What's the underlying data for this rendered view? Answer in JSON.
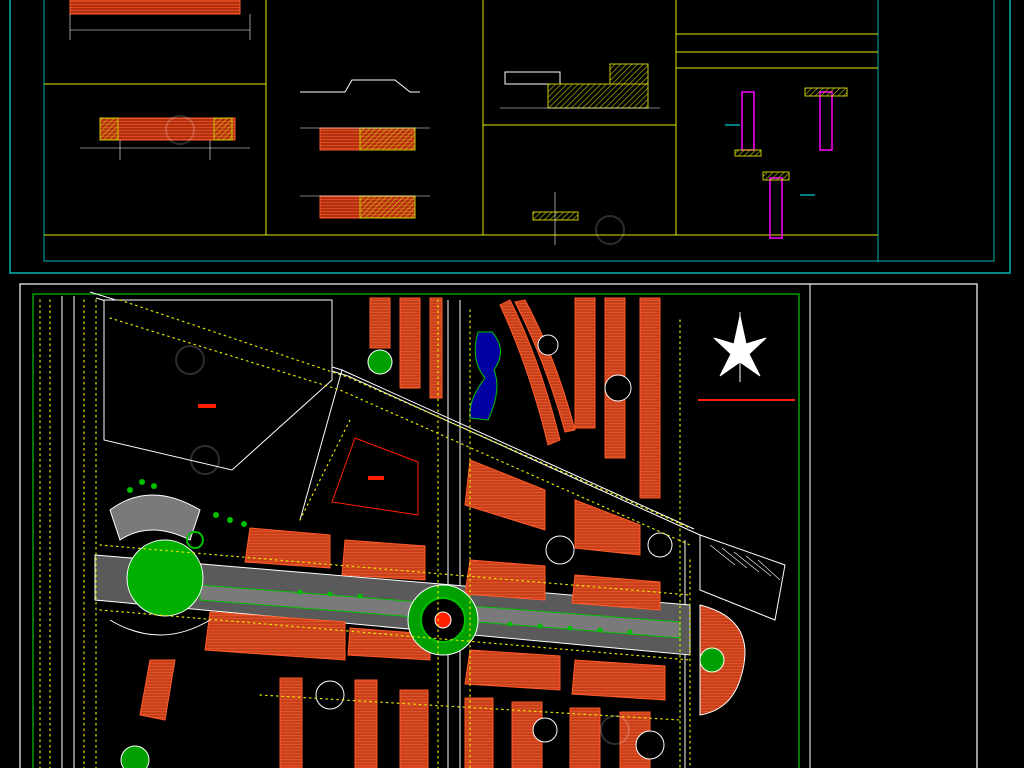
{
  "document": {
    "type": "CAD drawing sheets",
    "sheets": [
      {
        "role": "construction-details-sheet",
        "panels": 4
      },
      {
        "role": "site-master-plan"
      }
    ]
  },
  "colors": {
    "background": "#000000",
    "frame": "#00b3b3",
    "panel_line": "#e6e600",
    "detail_line": "#ffffff",
    "hatch": "#c8c800",
    "building_fill": "#c8401a",
    "building_edge": "#ff5a2a",
    "tree": "#e6e600",
    "lawn": "#00c000",
    "road": "#ffffff",
    "plaza": "#9a9a9a",
    "water": "#0000a0",
    "magenta": "#ff00ff",
    "cyan": "#00ffff",
    "red": "#ff2000",
    "watermark": "#ffffff"
  },
  "icons": {
    "north_arrow": "north-arrow-icon",
    "watermark": "watermark-logo"
  }
}
